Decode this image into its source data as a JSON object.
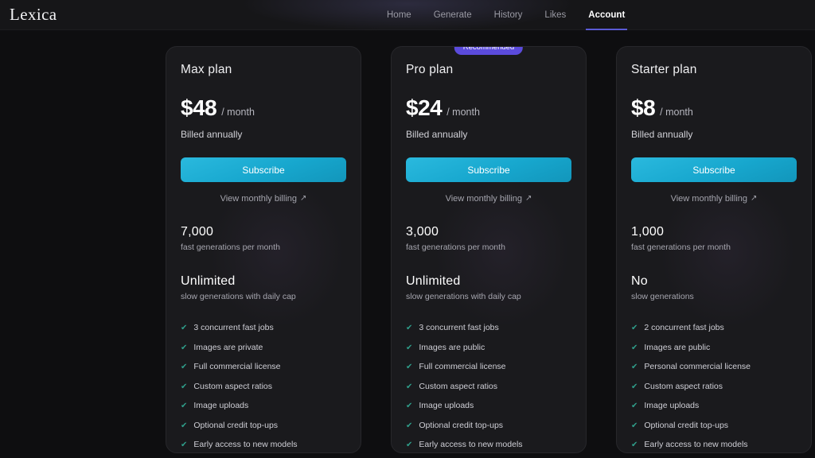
{
  "header": {
    "logo": "Lexica",
    "nav": [
      {
        "label": "Home",
        "active": false
      },
      {
        "label": "Generate",
        "active": false
      },
      {
        "label": "History",
        "active": false
      },
      {
        "label": "Likes",
        "active": false
      },
      {
        "label": "Account",
        "active": true
      }
    ]
  },
  "colors": {
    "page_background": "#0e0e10",
    "card_background": "#1a1a1d",
    "subscribe_accent": "#17a7ce",
    "badge_accent": "#5b4bdc",
    "check_accent": "#2f9e8a",
    "active_tab_underline": "#5b5bd6"
  },
  "plans": [
    {
      "name": "Max plan",
      "price": "$48",
      "period": "/ month",
      "billing_note": "Billed annually",
      "cta_label": "Subscribe",
      "monthly_link": "View monthly billing",
      "monthly_link_icon": "external-link-arrow",
      "badge": null,
      "fast": {
        "value": "7,000",
        "label": "fast generations per month"
      },
      "slow": {
        "value": "Unlimited",
        "label": "slow generations with daily cap"
      },
      "features": [
        "3 concurrent fast jobs",
        "Images are private",
        "Full commercial license",
        "Custom aspect ratios",
        "Image uploads",
        "Optional credit top-ups",
        "Early access to new models"
      ]
    },
    {
      "name": "Pro plan",
      "price": "$24",
      "period": "/ month",
      "billing_note": "Billed annually",
      "cta_label": "Subscribe",
      "monthly_link": "View monthly billing",
      "monthly_link_icon": "external-link-arrow",
      "badge": "Recommended",
      "fast": {
        "value": "3,000",
        "label": "fast generations per month"
      },
      "slow": {
        "value": "Unlimited",
        "label": "slow generations with daily cap"
      },
      "features": [
        "3 concurrent fast jobs",
        "Images are public",
        "Full commercial license",
        "Custom aspect ratios",
        "Image uploads",
        "Optional credit top-ups",
        "Early access to new models"
      ]
    },
    {
      "name": "Starter plan",
      "price": "$8",
      "period": "/ month",
      "billing_note": "Billed annually",
      "cta_label": "Subscribe",
      "monthly_link": "View monthly billing",
      "monthly_link_icon": "external-link-arrow",
      "badge": null,
      "fast": {
        "value": "1,000",
        "label": "fast generations per month"
      },
      "slow": {
        "value": "No",
        "label": "slow generations"
      },
      "features": [
        "2 concurrent fast jobs",
        "Images are public",
        "Personal commercial license",
        "Custom aspect ratios",
        "Image uploads",
        "Optional credit top-ups",
        "Early access to new models"
      ]
    }
  ]
}
